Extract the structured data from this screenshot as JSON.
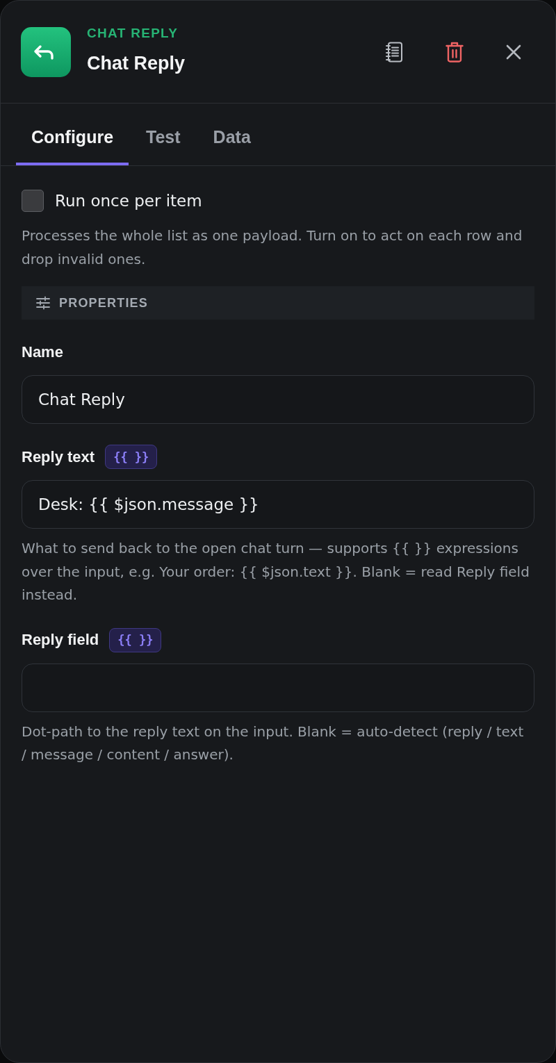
{
  "header": {
    "kicker": "CHAT REPLY",
    "title": "Chat Reply"
  },
  "tabs": [
    {
      "label": "Configure",
      "selected": true
    },
    {
      "label": "Test",
      "selected": false
    },
    {
      "label": "Data",
      "selected": false
    }
  ],
  "run_once": {
    "label": "Run once per item",
    "checked": false,
    "help": "Processes the whole list as one payload. Turn on to act on each row and drop invalid ones."
  },
  "section": {
    "title": "PROPERTIES"
  },
  "fields": [
    {
      "label": "Name",
      "value": "Chat Reply"
    },
    {
      "label": "Reply text",
      "badge": "{{ }}",
      "value": "Desk: {{ $json.message }}",
      "help": "What to send back to the open chat turn — supports {{ }} expressions over the input, e.g. Your order: {{ $json.text }}. Blank = read Reply field instead."
    },
    {
      "label": "Reply field",
      "badge": "{{ }}",
      "help": "Dot-path to the reply text on the input. Blank = auto-detect (reply / text / message / content / answer)."
    }
  ]
}
